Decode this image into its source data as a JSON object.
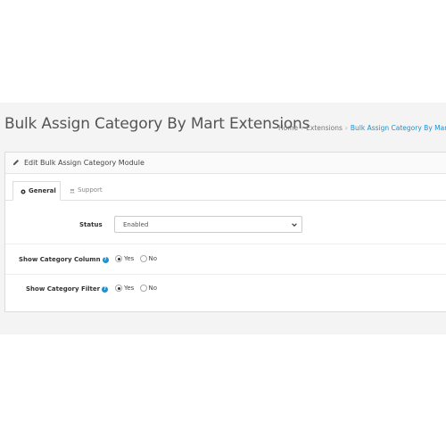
{
  "page": {
    "title": "Bulk Assign Category By Mart Extensions",
    "breadcrumb": [
      "Home",
      "Extensions",
      "Bulk Assign Category By Mart E"
    ]
  },
  "panel": {
    "title": "Edit Bulk Assign Category Module",
    "tabs": [
      {
        "label": "General",
        "icon": "gear-icon",
        "active": true
      },
      {
        "label": "Support",
        "icon": "users-icon",
        "active": false
      }
    ]
  },
  "form": {
    "status": {
      "label": "Status",
      "value": "Enabled"
    },
    "show_category_column": {
      "label": "Show Category Column",
      "options": [
        "Yes",
        "No"
      ],
      "selected": "Yes"
    },
    "show_category_filter": {
      "label": "Show Category Filter",
      "options": [
        "Yes",
        "No"
      ],
      "selected": "Yes"
    }
  },
  "colors": {
    "accent": "#1e91cf",
    "background": "#f4f4f4"
  }
}
